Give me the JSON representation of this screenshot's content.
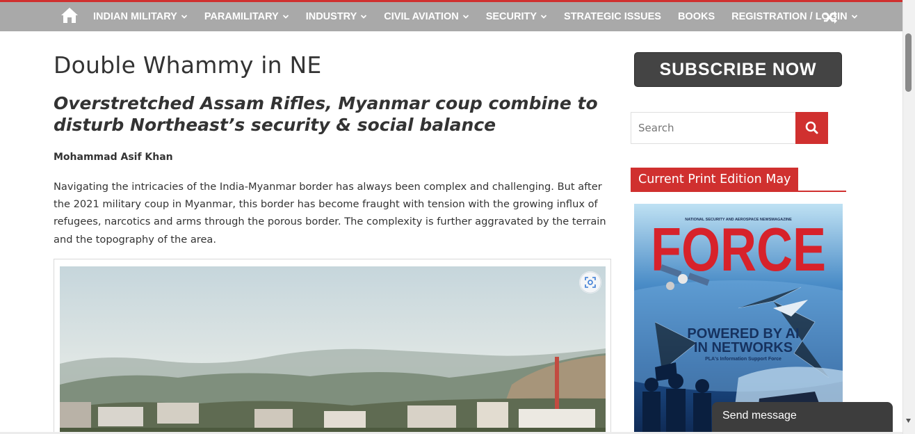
{
  "nav": {
    "home_icon": "home-icon",
    "items": [
      {
        "label": "Indian Military",
        "has_dropdown": true
      },
      {
        "label": "Paramilitary",
        "has_dropdown": true
      },
      {
        "label": "Industry",
        "has_dropdown": true
      },
      {
        "label": "Civil Aviation",
        "has_dropdown": true
      },
      {
        "label": "Security",
        "has_dropdown": true
      },
      {
        "label": "Strategic Issues",
        "has_dropdown": false
      },
      {
        "label": "Books",
        "has_dropdown": false
      },
      {
        "label": "Registration / Login",
        "has_dropdown": true
      }
    ],
    "random_icon": "shuffle-icon",
    "colors": {
      "bar": "#a9a9a9",
      "accent": "#d0302f"
    }
  },
  "article": {
    "title": "Double Whammy in NE",
    "subtitle": "Overstretched Assam Rifles, Myanmar coup combine to disturb Northeast’s security & social balance",
    "author": "Mohammad Asif Khan",
    "intro": "Navigating the intricacies of the India-Myanmar border has always been complex and challenging. But after the 2021 military coup in Myanmar, this border has become fraught with tension with the growing influx of refugees, narcotics and arms through the porous border. The complexity is further aggravated by the terrain and the topography of the area.",
    "image_zoom_icon": "zoom-scan-icon"
  },
  "sidebar": {
    "subscribe_label": "SUBSCRIBE NOW",
    "search_placeholder": "Search",
    "search_icon": "search-icon",
    "widget_title": "Current Print Edition May",
    "cover": {
      "kicker": "NATIONAL SECURITY AND AEROSPACE NEWSMAGAZINE",
      "masthead": "FORCE",
      "headline_1": "POWERED BY AI",
      "headline_2": "IN NETWORKS",
      "tagline": "PLA's Information Support Force"
    }
  },
  "chat": {
    "label": "Send message"
  }
}
